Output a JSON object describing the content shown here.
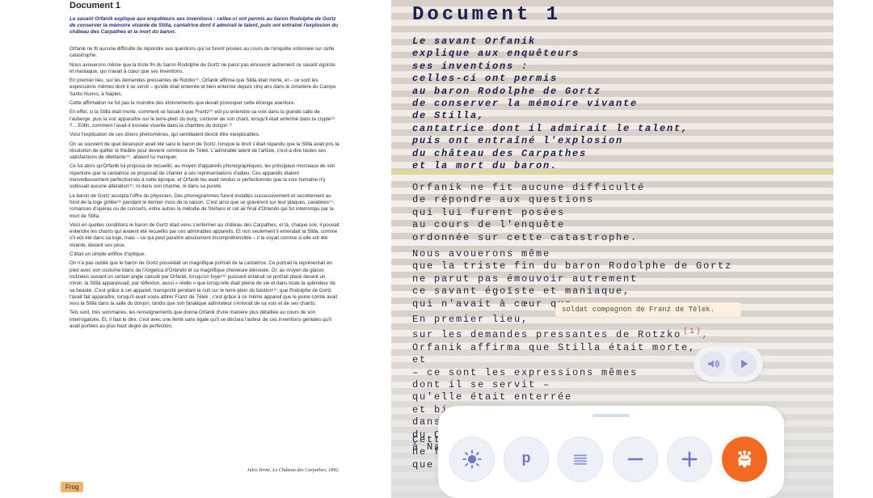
{
  "left": {
    "title": "Document 1",
    "intro": "Le savant Orfanik explique aux enquêteurs ses inventions : celles-ci ont permis au baron Rodolphe de Gortz de conserver la mémoire vivante de Stilla, cantatrice dont il admirait le talent, puis ont entraîné l'explosion du château des Carpathes et la mort du baron.",
    "paragraphs": [
      "Orfanik ne fit aucune difficulté de répondre aux questions qui lui furent posées au cours de l'enquête ordonnée sur cette catastrophe.",
      "Nous avouerons même que la triste fin du baron Rodolphe de Gortz ne parut pas émouvoir autrement ce savant égoïste et maniaque, qui n'avait à cœur que ses inventions.",
      "En premier lieu, sur les demandes pressantes de Rotzko⁽¹⁾, Orfanik affirma que Stilla était morte, et – ce sont les expressions mêmes dont il se servit – qu'elle était enterrée et bien enterrée depuis cinq ans dans le cimetière du Campo Santo Nuovo, à Naples.",
      "Cette affirmation ne fut pas le moindre des étonnements que devait provoquer cette étrange aventure.",
      "En effet, si la Stilla était morte, comment se faisait-il que Frantz⁽²⁾ eût pu entendre sa voix dans la grande salle de l'auberge, puis la voir apparaître sur le terre-plein du burg, s'enivrer de son chant, lorsqu'il était enfermé dans la crypte⁽³⁾ ?... Enfin, comment l'avait-il trouvée vivante dans la chambre du donjon ?",
      "Voici l'explication de ces divers phénomènes, qui semblaient devoir être inexplicables.",
      "On se souvient de quel désespoir avait été saisi le baron de Gortz, lorsque le bruit s'était répandu que la Stilla avait pris la résolution de quitter le théâtre pour devenir comtesse de Télek. L'admirable talent de l'artiste, c'est-à-dire toutes ses satisfactions de dilettante⁽⁴⁾, allaient lui manquer.",
      "Ce fut alors qu'Orfanik lui proposa de recueillir, au moyen d'appareils phonographiques, les principaux morceaux de son répertoire que la cantatrice se proposait de chanter à ses représentations d'adieu. Ces appareils étaient merveilleusement perfectionnés à cette époque, et Orfanik les avait rendus si perfectionnés que la voix humaine n'y subissait aucune altération⁽⁵⁾, ni dans son charme, ni dans sa pureté.",
      "Le baron de Gortz accepta l'offre du physicien. Des phonogrammes furent installés successivement et secrètement au fond de la loge grillée⁽⁶⁾ pendant le dernier mois de la saison. C'est ainsi que se gravèrent sur leur plaques, cavatines⁽⁷⁾, romances d'opéras ou de concerts, entre autres la mélodie de Stefano et cet air final d'Orlando qui fut interrompu par la mort de Stilla.",
      "Voici en quelles conditions le baron de Gortz était venu s'enfermer au château des Carpathes, et là, chaque soir, il pouvait entendre les chants qui avaient été recueillis par ces admirables appareils. Et non seulement il entendait la Stilla, comme s'il eût été dans sa loge, mais – ce qui peut paraître absolument incompréhensible – il la voyait comme si elle eût été vivante, devant ses yeux.",
      "C'était un simple artifice d'optique.",
      "On n'a pas oublié que le baron de Gortz possédait un magnifique portrait de la cantatrice. Ce portrait la représentait en pied avec son costume blanc de l'Angelica d'Orlando et sa magnifique chevelure dénouée. Or, au moyen de glaces inclinées suivant un certain angle calculé par Orfanik, lorsqu'un foyer⁽⁸⁾ puissant éclairait ce portrait placé devant un miroir, la Stilla apparaissait, par réflexion, aussi « réelle » que lorsqu'elle était pleine de vie et dans toute la splendeur de sa beauté. C'est grâce à cet appareil, transporté pendant la nuit sur le terre-plein du bastion⁽⁹⁾, que Rodolphe de Gortz l'avait fait apparaître, lorsqu'il avait voulu attirer Franz de Télek ; c'est grâce à ce même appareil que le jeune comte avait revu la Stilla dans la salle du donjon, tandis que son fanatique admirateur s'enivrait de sa voix et de ses chants.",
      "Tels sont, très sommaires, les renseignements que donna Orfanik d'une manière plus détaillée au cours de son interrogatoire. Et, il faut le dire, c'est avec une fierté sans égale qu'il se déclara l'auteur de ces inventions géniales qu'il avait portées au plus haut degré de perfection."
    ],
    "signature": "Jules Verne, Le Château des Carpathes, 1892.",
    "tag": "Frog"
  },
  "reader": {
    "title": "Document 1",
    "intro_lines": [
      "Le savant Orfanik",
      "explique aux enquêteurs",
      "ses inventions :",
      "celles-ci ont permis",
      "au baron Rodolphe de Gortz",
      "de conserver la mémoire vivante",
      "de Stilla,",
      "cantatrice dont il admirait le talent,",
      "puis ont entraîné l'explosion",
      "du château des Carpathes",
      "et la mort du baron."
    ],
    "block1": [
      "Orfanik ne fit aucune difficulté",
      "de répondre aux questions",
      "qui lui furent posées",
      "au cours de l'enquête",
      "ordonnée sur cette catastrophe."
    ],
    "block2": [
      "Nous avouerons même",
      "que la triste fin du baron Rodolphe de Gortz",
      "ne parut pas émouvoir autrement",
      "ce savant égoïste et maniaque,",
      "qui n'avait à cœur que"
    ],
    "block3": [
      "En premier lieu,",
      "sur les demandes pressantes de Rotzko",
      "Orfanik affirma que Stilla était morte,",
      "et",
      "– ce sont les expressions mêmes",
      "dont il se servit –",
      "qu'elle était enterrée",
      "et bie",
      "dans",
      "du C",
      "à Na"
    ],
    "block4": [
      "Cette",
      "ne f",
      "que"
    ],
    "footnote_1": "(1)",
    "comma": ",",
    "tooltip": "soldat compagnon de Franz de Télek."
  },
  "toolbar": {
    "font_label": "p"
  },
  "icons": {
    "speaker": "volume-icon",
    "play": "play-icon",
    "sun": "sun-icon",
    "lines": "line-spacing-icon",
    "minus": "minus-icon",
    "plus": "plus-icon",
    "frog": "frog-icon"
  },
  "colors": {
    "reader_bg_dark": "#d7d0c8",
    "reader_bg_light": "#f3efea",
    "title": "#1b1f52",
    "body": "#26233a",
    "accent": "#f26a21",
    "divider": "#efe34d",
    "tooltip_bg": "#fdf0df"
  }
}
